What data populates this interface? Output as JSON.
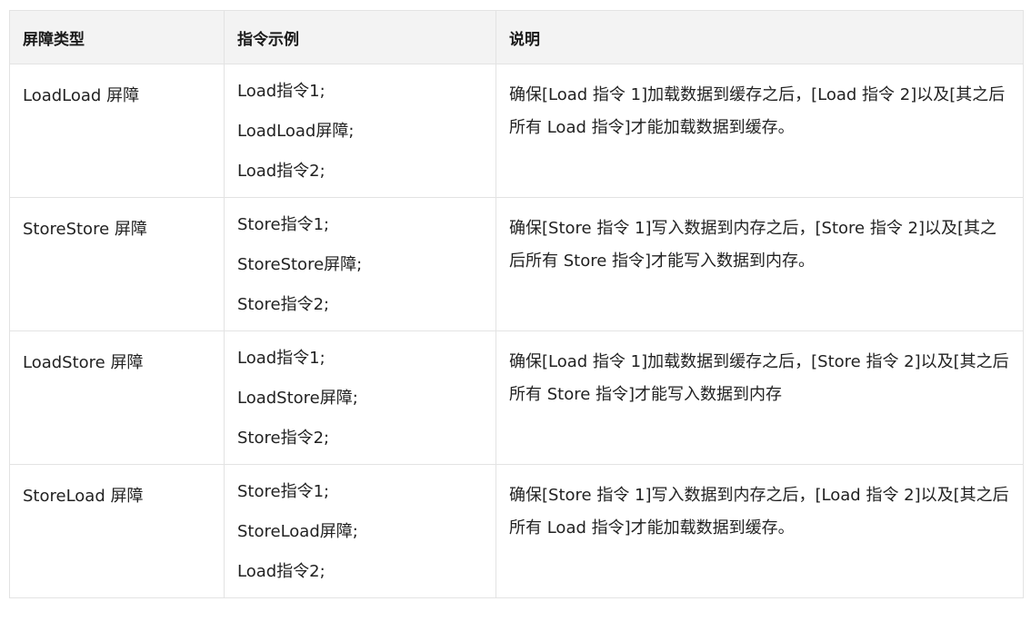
{
  "headers": {
    "type": "屏障类型",
    "instruction": "指令示例",
    "description": "说明"
  },
  "rows": [
    {
      "type": "LoadLoad 屏障",
      "instructions": [
        "Load指令1;",
        "LoadLoad屏障;",
        "Load指令2;"
      ],
      "description": "确保[Load 指令 1]加载数据到缓存之后，[Load 指令 2]以及[其之后所有 Load 指令]才能加载数据到缓存。"
    },
    {
      "type": "StoreStore 屏障",
      "instructions": [
        "Store指令1;",
        "StoreStore屏障;",
        "Store指令2;"
      ],
      "description": "确保[Store 指令 1]写入数据到内存之后，[Store 指令 2]以及[其之后所有 Store 指令]才能写入数据到内存。"
    },
    {
      "type": "LoadStore 屏障",
      "instructions": [
        "Load指令1;",
        "LoadStore屏障;",
        "Store指令2;"
      ],
      "description": "确保[Load 指令 1]加载数据到缓存之后，[Store 指令 2]以及[其之后所有 Store 指令]才能写入数据到内存"
    },
    {
      "type": "StoreLoad 屏障",
      "instructions": [
        "Store指令1;",
        "StoreLoad屏障;",
        "Load指令2;"
      ],
      "description": "确保[Store 指令 1]写入数据到内存之后，[Load 指令 2]以及[其之后所有 Load 指令]才能加载数据到缓存。"
    }
  ]
}
